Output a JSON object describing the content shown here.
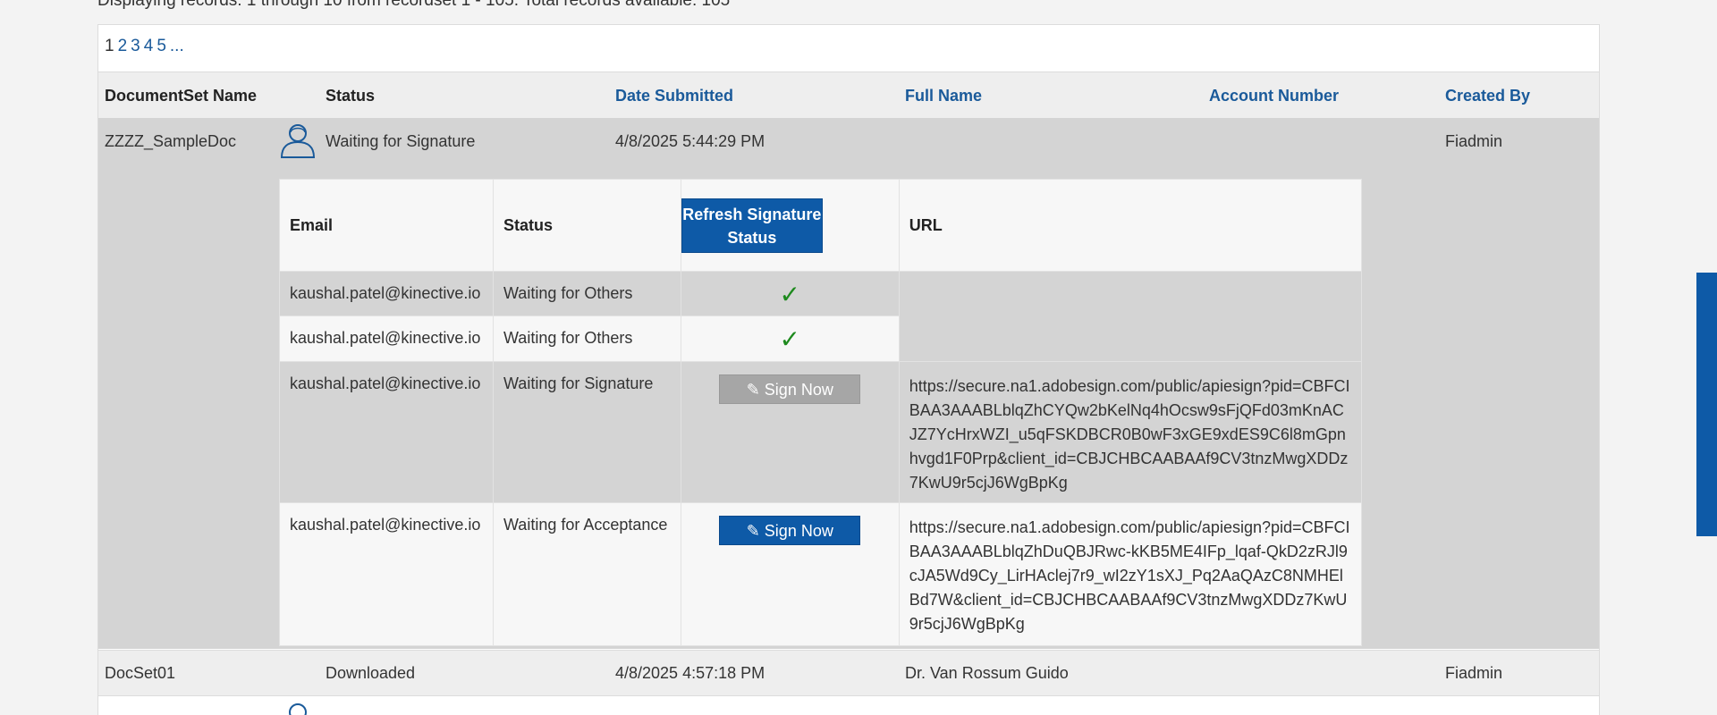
{
  "summary": "Displaying records: 1 through 10 from recordset 1 - 105. Total records available: 105",
  "pager": {
    "current": "1",
    "pages": [
      "2",
      "3",
      "4",
      "5"
    ],
    "more": "..."
  },
  "columns": {
    "name": "DocumentSet Name",
    "status": "Status",
    "date": "Date Submitted",
    "full_name": "Full Name",
    "account": "Account Number",
    "created_by": "Created By"
  },
  "rows": [
    {
      "name": "ZZZZ_SampleDoc",
      "status": "Waiting for Signature",
      "date": "4/8/2025 5:44:29 PM",
      "full_name": "",
      "account": "",
      "created_by": "Fiadmin",
      "signers": {
        "headers": {
          "email": "Email",
          "status": "Status",
          "refresh": "Refresh Signature Status",
          "url": "URL"
        },
        "items": [
          {
            "email": "kaushal.patel@kinective.io",
            "status": "Waiting for Others",
            "action": "check",
            "url": ""
          },
          {
            "email": "kaushal.patel@kinective.io",
            "status": "Waiting for Others",
            "action": "check",
            "url": ""
          },
          {
            "email": "kaushal.patel@kinective.io",
            "status": "Waiting for Signature",
            "action": "Sign Now",
            "url": "https://secure.na1.adobesign.com/public/apiesign?pid=CBFCIBAA3AAABLblqZhCYQw2bKelNq4hOcsw9sFjQFd03mKnACJZ7YcHrxWZI_u5qFSKDBCR0B0wF3xGE9xdES9C6l8mGpnhvgd1F0Prp&client_id=CBJCHBCAABAAf9CV3tnzMwgXDDz7KwU9r5cjJ6WgBpKg"
          },
          {
            "email": "kaushal.patel@kinective.io",
            "status": "Waiting for Acceptance",
            "action": "Sign Now",
            "url": "https://secure.na1.adobesign.com/public/apiesign?pid=CBFCIBAA3AAABLblqZhDuQBJRwc-kKB5ME4IFp_lqaf-QkD2zRJl9cJA5Wd9Cy_LirHAclej7r9_wI2zY1sXJ_Pq2AaQAzC8NMHElBd7W&client_id=CBJCHBCAABAAf9CV3tnzMwgXDDz7KwU9r5cjJ6WgBpKg"
          }
        ]
      }
    },
    {
      "name": "DocSet01",
      "status": "Downloaded",
      "date": "4/8/2025 4:57:18 PM",
      "full_name": "Dr. Van Rossum Guido",
      "account": "",
      "created_by": "Fiadmin"
    }
  ],
  "icons": {
    "person": "person-outline-icon",
    "check": "checkmark-icon",
    "pen": "pen-icon"
  },
  "colors": {
    "accent": "#0e5aa7",
    "check": "#1e8a1e",
    "row_dark": "#d4d4d4",
    "link": "#1a5a9a"
  }
}
